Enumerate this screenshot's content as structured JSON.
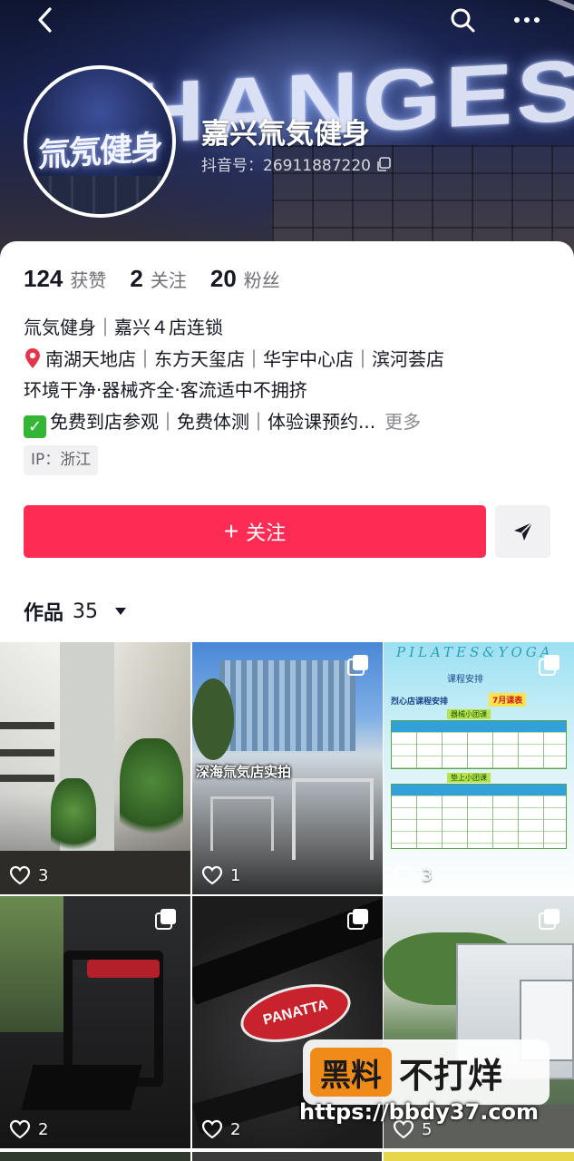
{
  "header": {
    "banner_text": "CHANGEST",
    "avatar_text": "氚氖健身",
    "name": "嘉兴氚気健身",
    "douyin_id": "抖音号：26911887220"
  },
  "stats": [
    {
      "value": "124",
      "label": "获赞"
    },
    {
      "value": "2",
      "label": "关注"
    },
    {
      "value": "20",
      "label": "粉丝"
    }
  ],
  "bio": {
    "line1": "氚気健身｜嘉兴４店连锁",
    "line2": "南湖天地店｜东方天玺店｜华宇中心店｜滨河荟店",
    "line3": "环境干净·器械齐全·客流适中不拥挤",
    "line4": "免费到店参观｜免费体测｜体验课预约...",
    "more": "更多"
  },
  "ip": "IP：浙江",
  "actions": {
    "follow_plus": "+",
    "follow_label": "关注"
  },
  "works": {
    "label": "作品",
    "count": "35"
  },
  "tiles": [
    {
      "likes": "3"
    },
    {
      "likes": "1",
      "caption": "深海氚気店实拍"
    },
    {
      "likes": "3",
      "title": "PILATES&YOGA",
      "subtitle": "课程安排",
      "store": "烈心店课程安排",
      "badge": "7月课表",
      "tag1": "器械小团课",
      "tag2": "垫上小团课"
    },
    {
      "likes": "2"
    },
    {
      "likes": "2",
      "brand": "PANATTA"
    },
    {
      "likes": "5"
    }
  ],
  "watermark": {
    "logo": "黑料",
    "text": "不打烊",
    "url": "https://bbdy37.com"
  },
  "colors": {
    "accent": "#fe2c55",
    "text_primary": "#161823",
    "text_secondary": "#6f7077"
  }
}
